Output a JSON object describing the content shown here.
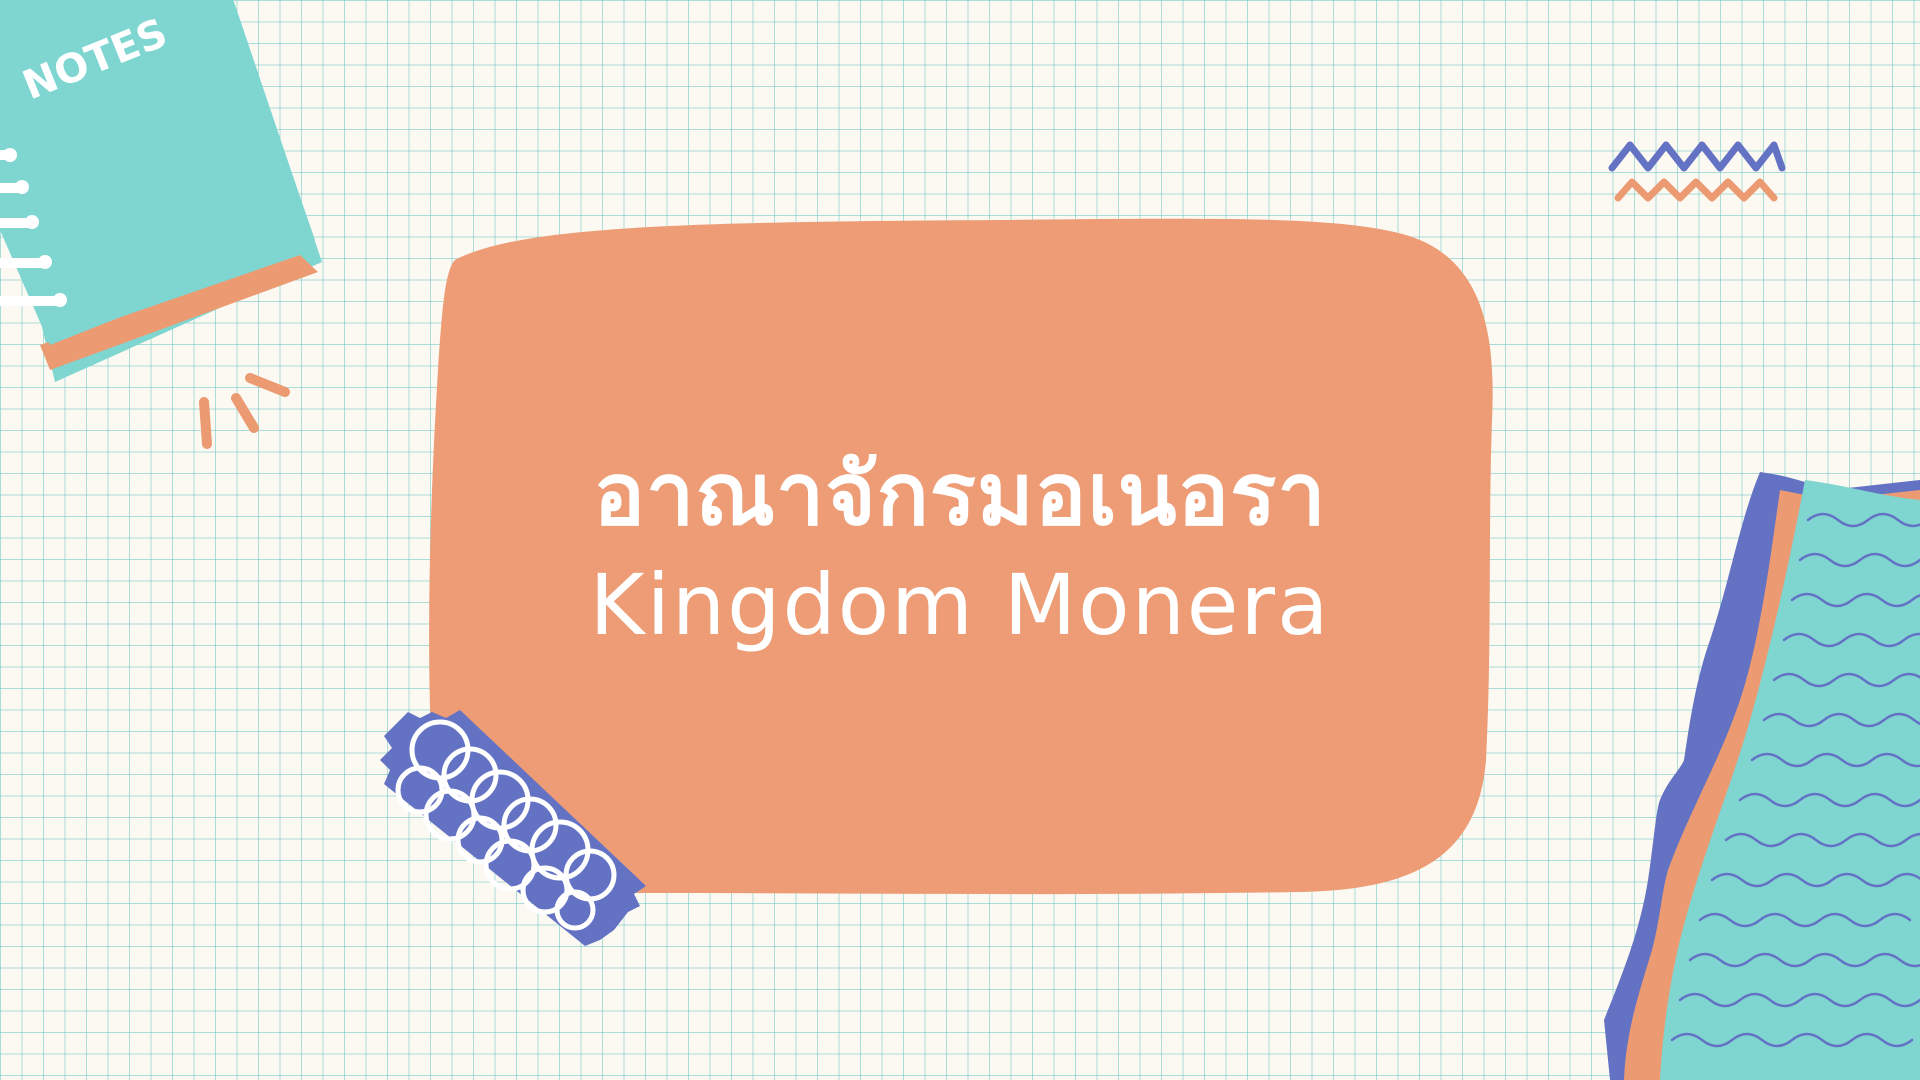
{
  "notebook": {
    "label": "NOTES"
  },
  "title": {
    "thai": "อาณาจักรมอเนอรา",
    "english": "Kingdom Monera"
  },
  "colors": {
    "background": "#fbf9f1",
    "grid": "#6ac4c4",
    "blob": "#ed9c76",
    "teal": "#7fd6d1",
    "blue": "#6472c4",
    "orange": "#ec9a72",
    "text": "#ffffff"
  }
}
